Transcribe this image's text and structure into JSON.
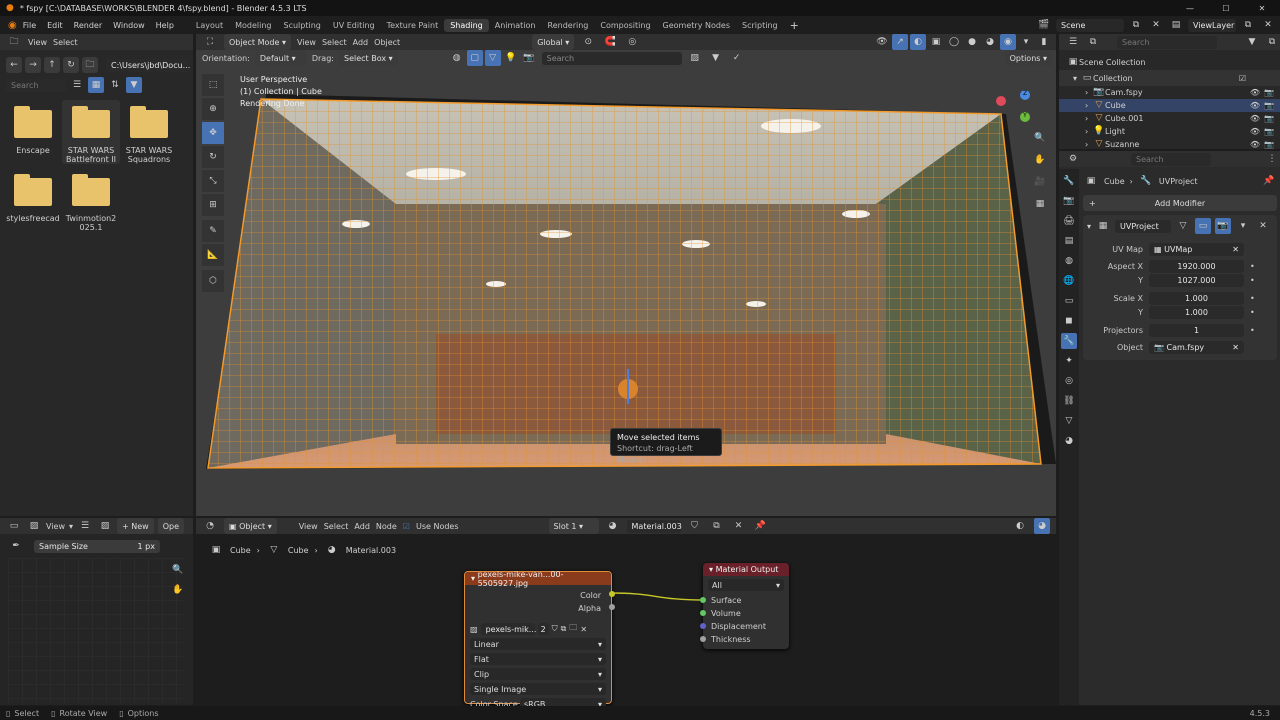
{
  "window": {
    "title": "* fspy [C:\\DATABASE\\WORKS\\BLENDER 4\\fspy.blend] - Blender 4.5.3 LTS",
    "scene": "Scene",
    "view_layer": "ViewLayer"
  },
  "menus": [
    "File",
    "Edit",
    "Render",
    "Window",
    "Help"
  ],
  "workspaces": [
    "Layout",
    "Modeling",
    "Sculpting",
    "UV Editing",
    "Texture Paint",
    "Shading",
    "Animation",
    "Rendering",
    "Compositing",
    "Geometry Nodes",
    "Scripting"
  ],
  "active_workspace": "Shading",
  "file_browser": {
    "view": "View",
    "select": "Select",
    "path": "C:\\Users\\jbd\\Docu...",
    "search_placeholder": "Search",
    "folders": [
      {
        "name": "Enscape"
      },
      {
        "name": "STAR WARS Battlefront II"
      },
      {
        "name": "STAR WARS Squadrons"
      },
      {
        "name": "stylesfreecad"
      },
      {
        "name": "Twinmotion2 025.1"
      }
    ]
  },
  "viewport": {
    "mode": "Object Mode",
    "menus": [
      "View",
      "Select",
      "Add",
      "Object"
    ],
    "transform": "Global",
    "orientation_label": "Orientation:",
    "orientation_value": "Default",
    "drag_label": "Drag:",
    "drag_value": "Select Box",
    "search_placeholder": "Search",
    "options": "Options",
    "overlay_line1": "User Perspective",
    "overlay_line2": "(1) Collection | Cube",
    "overlay_line3": "Rendering Done",
    "tooltip_title": "Move selected items",
    "tooltip_shortcut": "Shortcut: drag-Left Mouse",
    "gizmo": {
      "x": "X",
      "y": "Y",
      "z": "Z"
    }
  },
  "outliner": {
    "search_placeholder": "Search",
    "root": "Scene Collection",
    "collection": "Collection",
    "items": [
      {
        "name": "Cam.fspy",
        "icon": "camera-icon"
      },
      {
        "name": "Cube",
        "icon": "mesh-icon"
      },
      {
        "name": "Cube.001",
        "icon": "mesh-icon"
      },
      {
        "name": "Light",
        "icon": "light-icon"
      },
      {
        "name": "Suzanne",
        "icon": "mesh-icon"
      }
    ]
  },
  "properties": {
    "search_placeholder": "Search",
    "breadcrumb_object": "Cube",
    "breadcrumb_modifier": "UVProject",
    "add_modifier": "Add Modifier",
    "modifier_name": "UVProject",
    "uv_map_label": "UV Map",
    "uv_map_value": "UVMap",
    "aspect_x_label": "Aspect X",
    "aspect_x_value": "1920.000",
    "aspect_y_label": "Y",
    "aspect_y_value": "1027.000",
    "scale_x_label": "Scale X",
    "scale_x_value": "1.000",
    "scale_y_label": "Y",
    "scale_y_value": "1.000",
    "projectors_label": "Projectors",
    "projectors_value": "1",
    "object_label": "Object",
    "object_value": "Cam.fspy"
  },
  "image_editor": {
    "view": "View",
    "new": "New",
    "open": "Ope",
    "sample_size_label": "Sample Size",
    "sample_size_value": "1 px"
  },
  "node_editor": {
    "object": "Object",
    "menus": [
      "View",
      "Select",
      "Add",
      "Node"
    ],
    "use_nodes": "Use Nodes",
    "slot": "Slot 1",
    "material": "Material.003",
    "breadcrumb": [
      "Cube",
      "Cube",
      "Material.003"
    ],
    "image_node": {
      "title": "pexels-mike-van...00-5505927.jpg",
      "out_color": "Color",
      "out_alpha": "Alpha",
      "image_name": "pexels-mik...",
      "users": "2",
      "interpolation": "Linear",
      "projection": "Flat",
      "extension": "Clip",
      "source": "Single Image",
      "color_space_label": "Color Space",
      "color_space_value": "sRGB"
    },
    "output_node": {
      "title": "Material Output",
      "target": "All",
      "in_surface": "Surface",
      "in_volume": "Volume",
      "in_displacement": "Displacement",
      "in_thickness": "Thickness"
    }
  },
  "statusbar": {
    "select": "Select",
    "rotate": "Rotate View",
    "options": "Options",
    "version": "4.5.3"
  },
  "colors": {
    "accent_blue": "#4772b3",
    "selection_orange": "#f39a2a",
    "header_image_node": "#8a3b1c",
    "header_output_node": "#6a2028"
  }
}
